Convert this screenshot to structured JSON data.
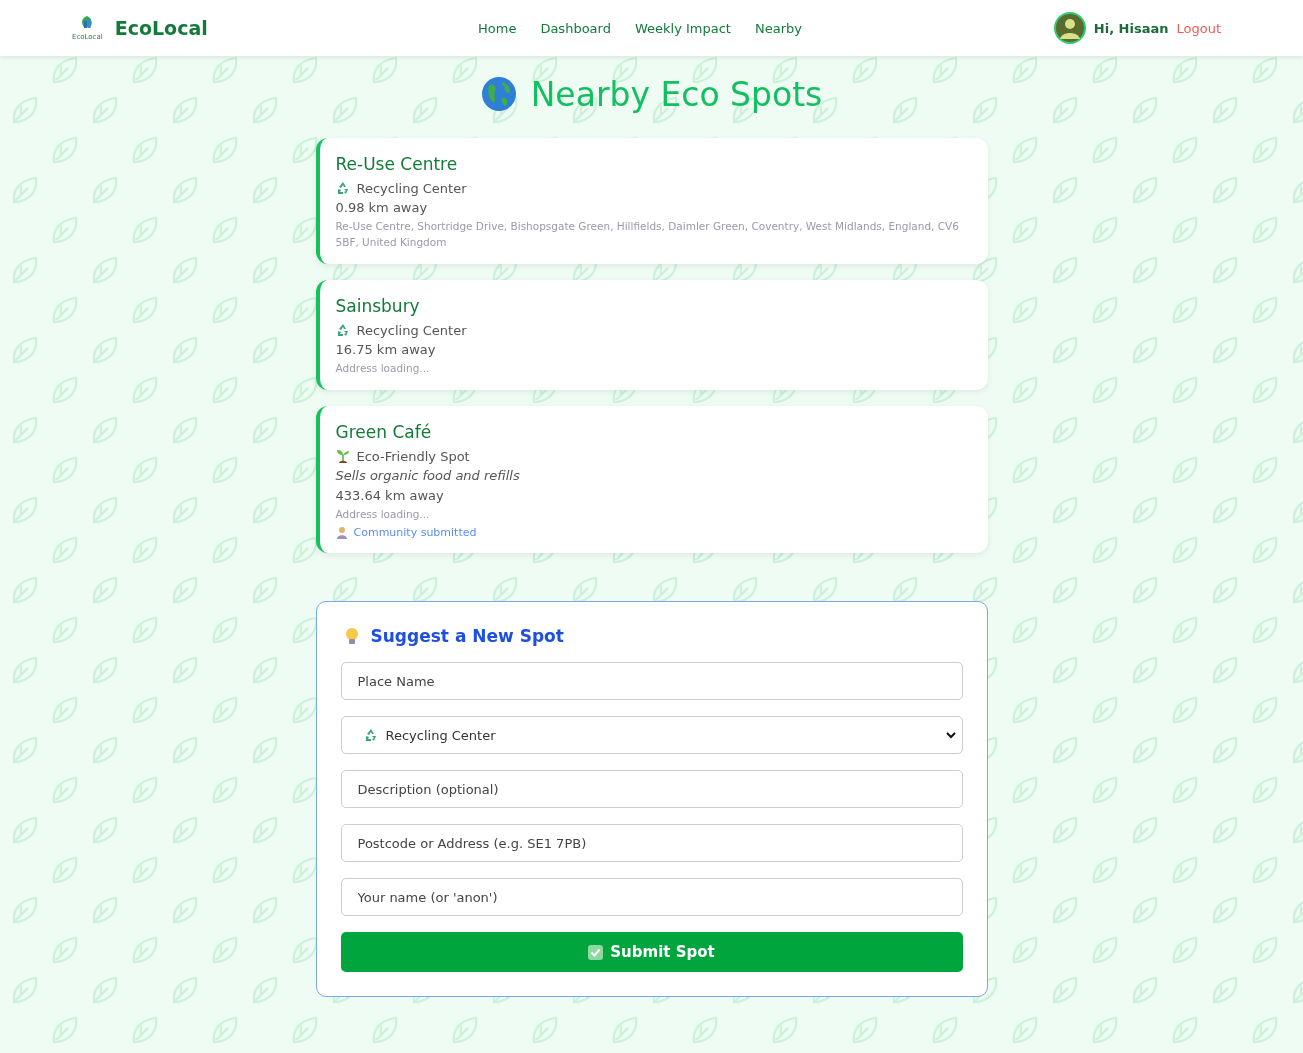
{
  "brand": {
    "name": "EcoLocal",
    "logo_caption": "EcoLocal"
  },
  "nav": [
    {
      "label": "Home"
    },
    {
      "label": "Dashboard"
    },
    {
      "label": "Weekly Impact"
    },
    {
      "label": "Nearby"
    }
  ],
  "user": {
    "greeting": "Hi, Hisaan",
    "logout": "Logout"
  },
  "page_title": "Nearby Eco Spots",
  "spots": [
    {
      "name": "Re-Use Centre",
      "category": {
        "kind": "recycling",
        "label": "Recycling Center"
      },
      "distance": "0.98 km away",
      "address": "Re-Use Centre, Shortridge Drive, Bishopsgate Green, Hillfields, Daimler Green, Coventry, West Midlands, England, CV6 5BF, United Kingdom"
    },
    {
      "name": "Sainsbury",
      "category": {
        "kind": "recycling",
        "label": "Recycling Center"
      },
      "distance": "16.75 km away",
      "address": "Address loading..."
    },
    {
      "name": "Green Café",
      "category": {
        "kind": "eco",
        "label": "Eco-Friendly Spot"
      },
      "description": "Sells organic food and refills",
      "distance": "433.64 km away",
      "address": "Address loading...",
      "submitted_by": "Community submitted"
    }
  ],
  "form": {
    "title": "Suggest a New Spot",
    "fields": [
      {
        "kind": "text",
        "placeholder": "Place Name"
      },
      {
        "kind": "select",
        "value": "Recycling Center"
      },
      {
        "kind": "text",
        "placeholder": "Description (optional)"
      },
      {
        "kind": "text",
        "placeholder": "Postcode or Address (e.g. SE1 7PB)"
      },
      {
        "kind": "text",
        "placeholder": "Your name (or 'anon')"
      }
    ],
    "submit": "Submit Spot"
  }
}
